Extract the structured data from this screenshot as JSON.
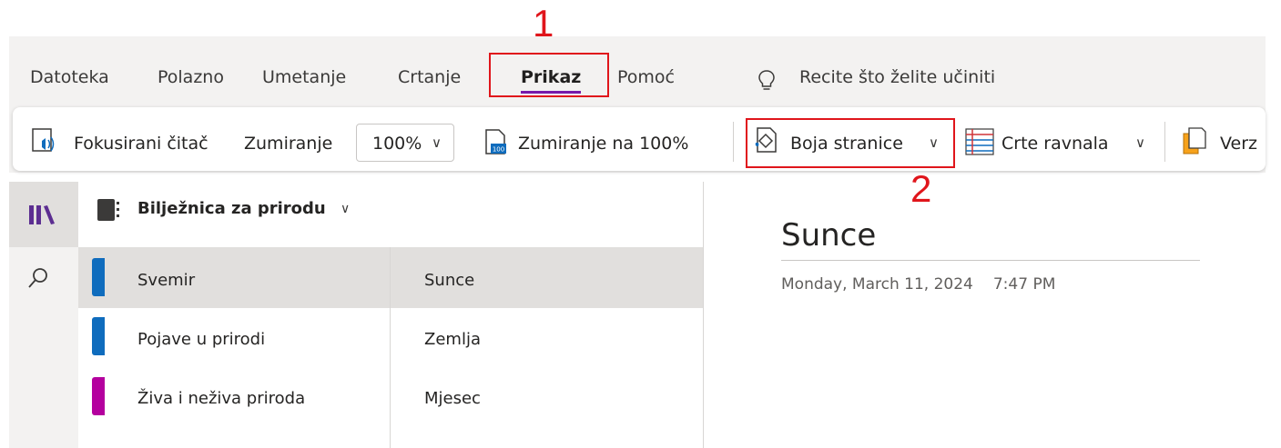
{
  "ribbon": {
    "tabs": [
      {
        "label": "Datoteka"
      },
      {
        "label": "Polazno"
      },
      {
        "label": "Umetanje"
      },
      {
        "label": "Crtanje"
      },
      {
        "label": "Prikaz",
        "active": true
      },
      {
        "label": "Pomoć"
      }
    ],
    "tell_me": "Recite što želite učiniti"
  },
  "toolbar": {
    "immersive_reader": "Fokusirani čitač",
    "zoom_label": "Zumiranje",
    "zoom_value": "100%",
    "zoom_100": "Zumiranje na 100%",
    "page_color": "Boja stranice",
    "rule_lines": "Crte ravnala",
    "versions": "Verz"
  },
  "annotations": {
    "step1": "1",
    "step2": "2",
    "color": "#e0151b"
  },
  "notebook": {
    "name": "Bilježnica za prirodu",
    "sections": [
      {
        "label": "Svemir",
        "color": "#0f6cbd",
        "selected": true
      },
      {
        "label": "Pojave u prirodi",
        "color": "#0f6cbd"
      },
      {
        "label": "Živa i neživa priroda",
        "color": "#b4009e"
      }
    ],
    "pages": [
      {
        "label": "Sunce",
        "selected": true
      },
      {
        "label": "Zemlja"
      },
      {
        "label": "Mjesec"
      }
    ]
  },
  "page": {
    "title": "Sunce",
    "date": "Monday, March 11, 2024",
    "time": "7:47 PM"
  },
  "colors": {
    "accent": "#7719aa",
    "rail_icon": "#5c2e91"
  }
}
